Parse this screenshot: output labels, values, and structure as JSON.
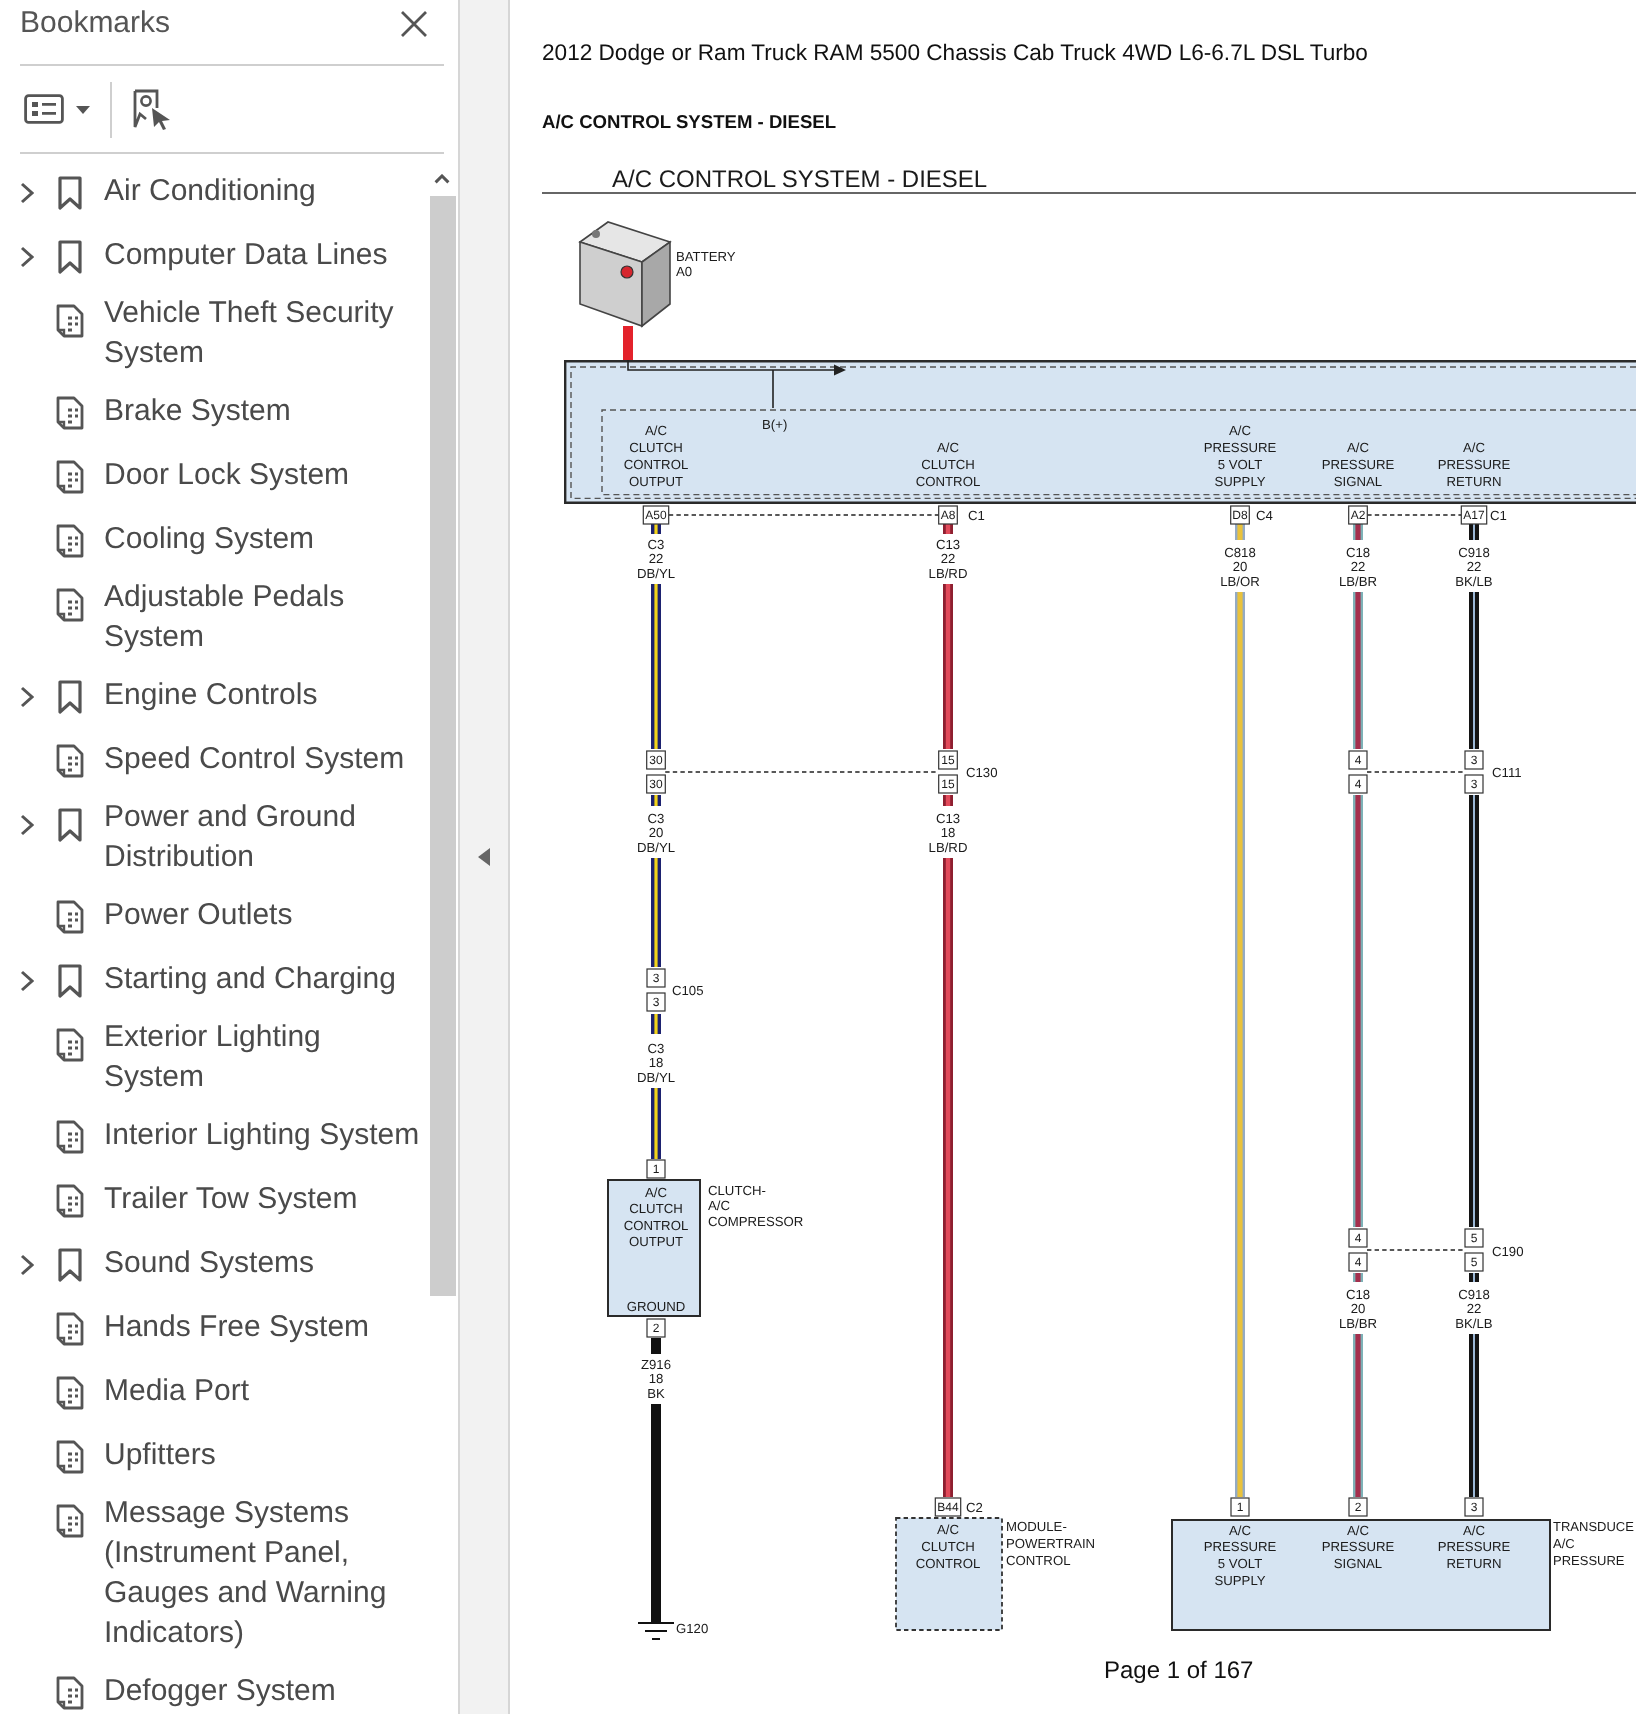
{
  "sidebar": {
    "title": "Bookmarks",
    "items": [
      {
        "label": "Air Conditioning",
        "kind": "folder"
      },
      {
        "label": "Computer Data Lines",
        "kind": "folder"
      },
      {
        "label": "Vehicle Theft Security System",
        "kind": "page"
      },
      {
        "label": "Brake System",
        "kind": "page"
      },
      {
        "label": "Door Lock System",
        "kind": "page"
      },
      {
        "label": "Cooling System",
        "kind": "page"
      },
      {
        "label": "Adjustable Pedals System",
        "kind": "page"
      },
      {
        "label": "Engine Controls",
        "kind": "folder"
      },
      {
        "label": "Speed Control System",
        "kind": "page"
      },
      {
        "label": "Power and Ground Distribution",
        "kind": "folder"
      },
      {
        "label": "Power Outlets",
        "kind": "page"
      },
      {
        "label": "Starting and Charging",
        "kind": "folder"
      },
      {
        "label": "Exterior Lighting System",
        "kind": "page"
      },
      {
        "label": "Interior Lighting System",
        "kind": "page"
      },
      {
        "label": "Trailer Tow System",
        "kind": "page"
      },
      {
        "label": "Sound Systems",
        "kind": "folder"
      },
      {
        "label": "Hands Free System",
        "kind": "page"
      },
      {
        "label": "Media Port",
        "kind": "page"
      },
      {
        "label": "Upfitters",
        "kind": "page"
      },
      {
        "label": "Message Systems (Instrument Panel, Gauges and Warning Indicators)",
        "kind": "page"
      },
      {
        "label": "Defogger System",
        "kind": "page"
      }
    ]
  },
  "document": {
    "header": "2012 Dodge or Ram Truck RAM 5500 Chassis Cab Truck 4WD L6-6.7L DSL Turbo",
    "section_title": "A/C CONTROL SYSTEM - DIESEL",
    "diagram": {
      "title": "A/C CONTROL SYSTEM - DIESEL",
      "battery": {
        "name": [
          "BATTERY",
          "A0"
        ]
      },
      "module": {
        "feed_label": "B(+)",
        "functions": [
          [
            "A/C",
            "CLUTCH",
            "CONTROL",
            "OUTPUT"
          ],
          [
            "A/C",
            "CLUTCH",
            "CONTROL"
          ],
          [
            "A/C",
            "PRESSURE",
            "5 VOLT",
            "SUPPLY"
          ],
          [
            "A/C",
            "PRESSURE",
            "SIGNAL"
          ],
          [
            "A/C",
            "PRESSURE",
            "RETURN"
          ]
        ]
      },
      "pins": [
        "A50",
        "A8",
        "D8",
        "A2",
        "A17",
        "30",
        "30",
        "15",
        "15",
        "4",
        "4",
        "3",
        "3",
        "3",
        "3",
        "1",
        "2",
        "4",
        "4",
        "5",
        "5",
        "B44",
        "1",
        "2",
        "3"
      ],
      "connector_labels": [
        "C1",
        "C4",
        "C1",
        "C130",
        "C111",
        "C105",
        "C190",
        "C2"
      ],
      "wire_labels": [
        [
          "C3",
          "22",
          "DB/YL"
        ],
        [
          "C13",
          "22",
          "LB/RD"
        ],
        [
          "C818",
          "20",
          "LB/OR"
        ],
        [
          "C18",
          "22",
          "LB/BR"
        ],
        [
          "C918",
          "22",
          "BK/LB"
        ],
        [
          "C3",
          "20",
          "DB/YL"
        ],
        [
          "C13",
          "18",
          "LB/RD"
        ],
        [
          "C3",
          "18",
          "DB/YL"
        ],
        [
          "Z916",
          "18",
          "BK"
        ],
        [
          "C18",
          "20",
          "LB/BR"
        ],
        [
          "C918",
          "22",
          "BK/LB"
        ]
      ],
      "clutch": {
        "name": [
          "CLUTCH-",
          "A/C",
          "COMPRESSOR"
        ],
        "functions": [
          [
            "A/C",
            "CLUTCH",
            "CONTROL",
            "OUTPUT"
          ],
          [
            "GROUND"
          ]
        ]
      },
      "ground_label": "G120",
      "pcm": {
        "name": [
          "MODULE-",
          "POWERTRAIN",
          "CONTROL"
        ],
        "functions": [
          [
            "A/C",
            "CLUTCH",
            "CONTROL"
          ]
        ]
      },
      "transducer": {
        "name": [
          "TRANSDUCE",
          "A/C",
          "PRESSURE"
        ],
        "functions": [
          [
            "A/C",
            "PRESSURE",
            "5 VOLT",
            "SUPPLY"
          ],
          [
            "A/C",
            "PRESSURE",
            "SIGNAL"
          ],
          [
            "A/C",
            "PRESSURE",
            "RETURN"
          ]
        ]
      }
    },
    "page_indicator": "Page 1 of 167"
  }
}
